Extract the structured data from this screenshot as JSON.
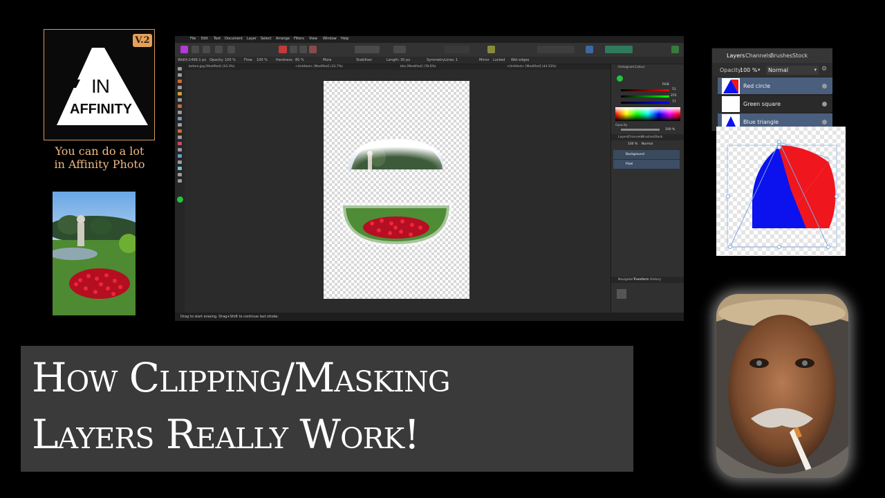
{
  "logo": {
    "version": "V.2",
    "word1": "IN",
    "word2": "AFFINITY",
    "frame_color": "#d99a5a",
    "badge_color": "#e3a15c"
  },
  "tagline": [
    "You can do a lot",
    "in Affinity Photo"
  ],
  "app": {
    "menu": [
      "File",
      "Edit",
      "Text",
      "Document",
      "Layer",
      "Select",
      "Arrange",
      "Filters",
      "View",
      "Window",
      "Help"
    ],
    "context_toolbar": [
      "Width:",
      "1499.1 px",
      "Opacity:",
      "100 %",
      "Flow:",
      "100 %",
      "Hardness:",
      "80 %",
      "More",
      "Stabiliser",
      "Length:",
      "30 px",
      "Symmetry",
      "Lines:",
      "1",
      "Mirror",
      "Locked",
      "Wet edges"
    ],
    "doc_tabs": [
      "before.jpg [Modified] (16.3%)",
      "<Untitled> [Modified] (33.7%)",
      "blio [Modified] (78.6%)",
      "<Untitled> [Modified] (44.53%)"
    ],
    "panel_tabs_top": [
      "Histogram",
      "Colour"
    ],
    "color_values": [
      "51",
      "255",
      "77"
    ],
    "color_mode": "RGB",
    "opacity_label": "Opacity",
    "opacity_value": "100 %",
    "panel_tabs_layers": [
      "Layers",
      "Channels",
      "Brushes",
      "Stock"
    ],
    "layers_opacity": "100 %",
    "layers_blend": "Normal",
    "layers": [
      "Background",
      "Pixel"
    ],
    "panel_tabs_nav": [
      "Navigator",
      "Transform",
      "History"
    ],
    "status_bar": "Drag to start erasing. Drag+Shift to continue last stroke."
  },
  "layers_panel": {
    "tabs": [
      "Layers",
      "Channels",
      "Brushes",
      "Stock"
    ],
    "opacity_label": "Opacity:",
    "opacity_value": "100 %",
    "blend_mode": "Normal",
    "items": [
      {
        "name": "Red circle",
        "selected": true
      },
      {
        "name": "Green square",
        "selected": false
      },
      {
        "name": "Blue triangle",
        "selected": true
      }
    ],
    "selection_color": "#4a5f7e"
  },
  "title": {
    "line1": "How Clipping/Masking",
    "line2": "Layers Really Work!"
  },
  "colors": {
    "accent_orange": "#f0b882",
    "red": "#f0161e",
    "blue": "#0b12ee",
    "green_swatch": "#22c33d"
  }
}
